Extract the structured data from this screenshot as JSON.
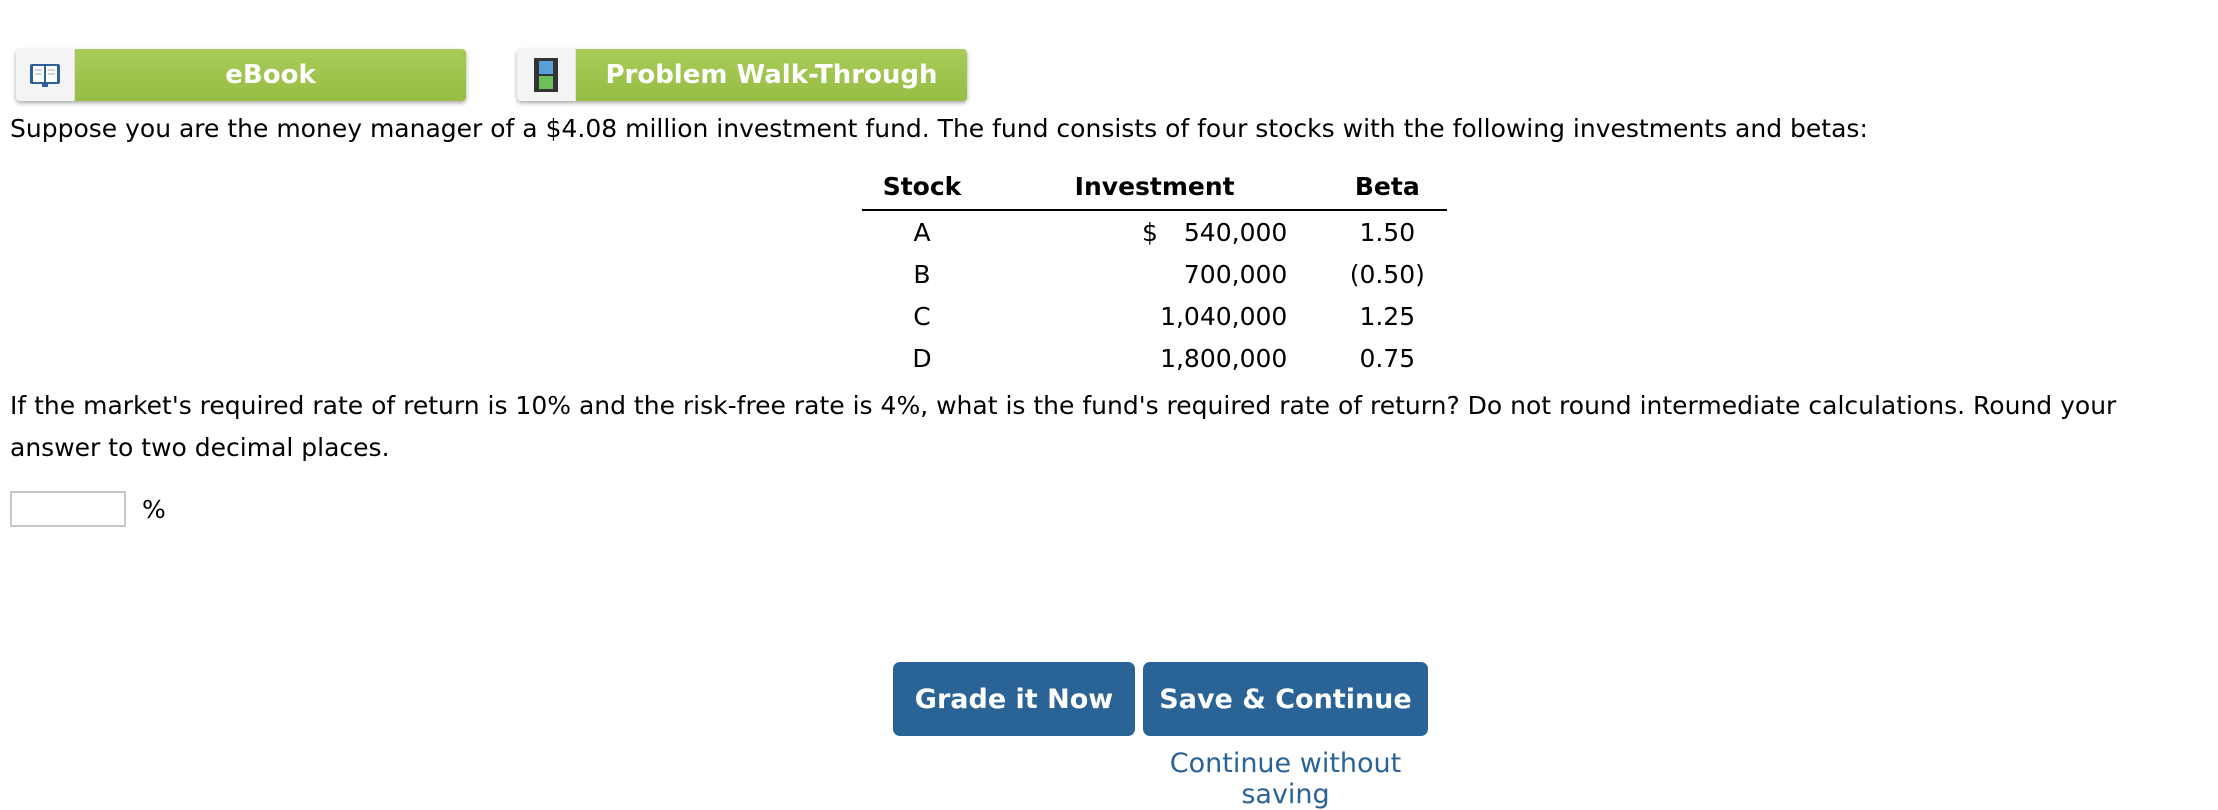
{
  "toolbar": {
    "ebook_label": "eBook",
    "ebook_icon": "book-icon",
    "walkthrough_label": "Problem Walk-Through",
    "walkthrough_icon": "film-icon"
  },
  "problem": {
    "intro": "Suppose you are the money manager of a $4.08 million investment fund. The fund consists of four stocks with the following investments and betas:",
    "table": {
      "headers": [
        "Stock",
        "Investment",
        "Beta"
      ],
      "rows": [
        {
          "stock": "A",
          "currency": "$",
          "investment": "540,000",
          "beta": "1.50"
        },
        {
          "stock": "B",
          "currency": "",
          "investment": "700,000",
          "beta": "(0.50)"
        },
        {
          "stock": "C",
          "currency": "",
          "investment": "1,040,000",
          "beta": "1.25"
        },
        {
          "stock": "D",
          "currency": "",
          "investment": "1,800,000",
          "beta": "0.75"
        }
      ]
    },
    "question": "If the market's required rate of return is 10% and the risk-free rate is 4%, what is the fund's required rate of return? Do not round intermediate calculations. Round your answer to two decimal places.",
    "answer_value": "",
    "answer_unit": "%"
  },
  "actions": {
    "grade_label": "Grade it Now",
    "save_label": "Save & Continue",
    "continue_label": "Continue without saving"
  },
  "colors": {
    "green": "#9bc24a",
    "blue": "#2a6395"
  }
}
